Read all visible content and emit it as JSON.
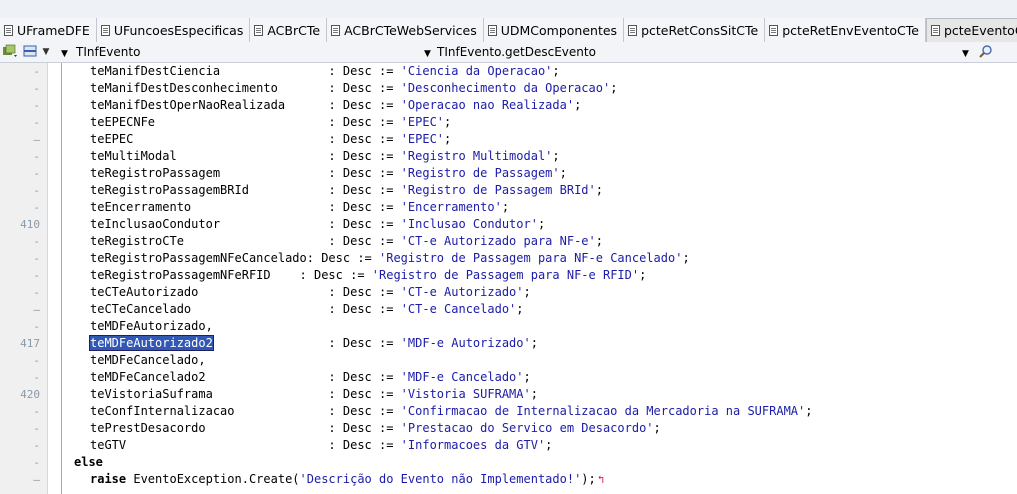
{
  "tabs": [
    {
      "label": "UFrameDFE",
      "active": false
    },
    {
      "label": "UFuncoesEspecificas",
      "active": false
    },
    {
      "label": "ACBrCTe",
      "active": false
    },
    {
      "label": "ACBrCTeWebServices",
      "active": false
    },
    {
      "label": "UDMComponentes",
      "active": false
    },
    {
      "label": "pcteRetConsSitCTe",
      "active": false
    },
    {
      "label": "pcteRetEnvEventoCTe",
      "active": false
    },
    {
      "label": "pcteEventoCTe",
      "active": true
    }
  ],
  "navbar": {
    "class_combo": "TInfEvento",
    "method_combo": "TInfEvento.getDescEvento"
  },
  "gutter": {
    "markers": [
      {
        "row": 0,
        "text": "-"
      },
      {
        "row": 1,
        "text": "-"
      },
      {
        "row": 2,
        "text": "-"
      },
      {
        "row": 3,
        "text": "-"
      },
      {
        "row": 4,
        "text": "–"
      },
      {
        "row": 5,
        "text": "-"
      },
      {
        "row": 6,
        "text": "-"
      },
      {
        "row": 7,
        "text": "-"
      },
      {
        "row": 8,
        "text": "-"
      },
      {
        "row": 9,
        "text": "410"
      },
      {
        "row": 10,
        "text": "-"
      },
      {
        "row": 11,
        "text": "-"
      },
      {
        "row": 12,
        "text": "-"
      },
      {
        "row": 13,
        "text": "-"
      },
      {
        "row": 14,
        "text": "–"
      },
      {
        "row": 15,
        "text": "-"
      },
      {
        "row": 16,
        "text": "417"
      },
      {
        "row": 17,
        "text": "-"
      },
      {
        "row": 18,
        "text": "-"
      },
      {
        "row": 19,
        "text": "420"
      },
      {
        "row": 20,
        "text": "-"
      },
      {
        "row": 21,
        "text": "-"
      },
      {
        "row": 22,
        "text": "-"
      },
      {
        "row": 23,
        "text": "-"
      },
      {
        "row": 24,
        "text": "–"
      }
    ]
  },
  "code": {
    "lines": [
      {
        "id": "teManifDestCiencia",
        "pad": "               ",
        "rest": ": Desc := ",
        "str": "'Ciencia da Operacao'",
        "tail": ";"
      },
      {
        "id": "teManifDestDesconhecimento",
        "pad": "       ",
        "rest": ": Desc := ",
        "str": "'Desconhecimento da Operacao'",
        "tail": ";"
      },
      {
        "id": "teManifDestOperNaoRealizada",
        "pad": "      ",
        "rest": ": Desc := ",
        "str": "'Operacao nao Realizada'",
        "tail": ";"
      },
      {
        "id": "teEPECNFe",
        "pad": "                        ",
        "rest": ": Desc := ",
        "str": "'EPEC'",
        "tail": ";"
      },
      {
        "id": "teEPEC",
        "pad": "                           ",
        "rest": ": Desc := ",
        "str": "'EPEC'",
        "tail": ";"
      },
      {
        "id": "teMultiModal",
        "pad": "                     ",
        "rest": ": Desc := ",
        "str": "'Registro Multimodal'",
        "tail": ";"
      },
      {
        "id": "teRegistroPassagem",
        "pad": "               ",
        "rest": ": Desc := ",
        "str": "'Registro de Passagem'",
        "tail": ";"
      },
      {
        "id": "teRegistroPassagemBRId",
        "pad": "           ",
        "rest": ": Desc := ",
        "str": "'Registro de Passagem BRId'",
        "tail": ";"
      },
      {
        "id": "teEncerramento",
        "pad": "                   ",
        "rest": ": Desc := ",
        "str": "'Encerramento'",
        "tail": ";"
      },
      {
        "id": "teInclusaoCondutor",
        "pad": "               ",
        "rest": ": Desc := ",
        "str": "'Inclusao Condutor'",
        "tail": ";"
      },
      {
        "id": "teRegistroCTe",
        "pad": "                    ",
        "rest": ": Desc := ",
        "str": "'CT-e Autorizado para NF-e'",
        "tail": ";"
      },
      {
        "id": "teRegistroPassagemNFeCancelado",
        "pad": "",
        "rest": ": Desc := ",
        "str": "'Registro de Passagem para NF-e Cancelado'",
        "tail": ";"
      },
      {
        "id": "teRegistroPassagemNFeRFID",
        "pad": "    ",
        "rest": ": Desc := ",
        "str": "'Registro de Passagem para NF-e RFID'",
        "tail": ";"
      },
      {
        "id": "teCTeAutorizado",
        "pad": "                  ",
        "rest": ": Desc := ",
        "str": "'CT-e Autorizado'",
        "tail": ";"
      },
      {
        "id": "teCTeCancelado",
        "pad": "                   ",
        "rest": ": Desc := ",
        "str": "'CT-e Cancelado'",
        "tail": ";"
      },
      {
        "id": "teMDFeAutorizado,",
        "pad": "",
        "rest": "",
        "str": "",
        "tail": ""
      },
      {
        "id": "teMDFeAutorizado2",
        "pad": "                ",
        "rest": ": Desc := ",
        "str": "'MDF-e Autorizado'",
        "tail": ";",
        "selected": true
      },
      {
        "id": "teMDFeCancelado,",
        "pad": "",
        "rest": "",
        "str": "",
        "tail": ""
      },
      {
        "id": "teMDFeCancelado2",
        "pad": "                 ",
        "rest": ": Desc := ",
        "str": "'MDF-e Cancelado'",
        "tail": ";"
      },
      {
        "id": "teVistoriaSuframa",
        "pad": "                ",
        "rest": ": Desc := ",
        "str": "'Vistoria SUFRAMA'",
        "tail": ";"
      },
      {
        "id": "teConfInternalizacao",
        "pad": "             ",
        "rest": ": Desc := ",
        "str": "'Confirmacao de Internalizacao da Mercadoria na SUFRAMA'",
        "tail": ";"
      },
      {
        "id": "tePrestDesacordo",
        "pad": "                 ",
        "rest": ": Desc := ",
        "str": "'Prestacao do Servico em Desacordo'",
        "tail": ";"
      },
      {
        "id": "teGTV",
        "pad": "                            ",
        "rest": ": Desc := ",
        "str": "'Informacoes da GTV'",
        "tail": ";"
      }
    ],
    "else_keyword": "else",
    "raise_keyword": "raise",
    "raise_call": "EventoException.Create(",
    "raise_string": "'Descrição do Evento não Implementado!'",
    "raise_tail": ");"
  }
}
